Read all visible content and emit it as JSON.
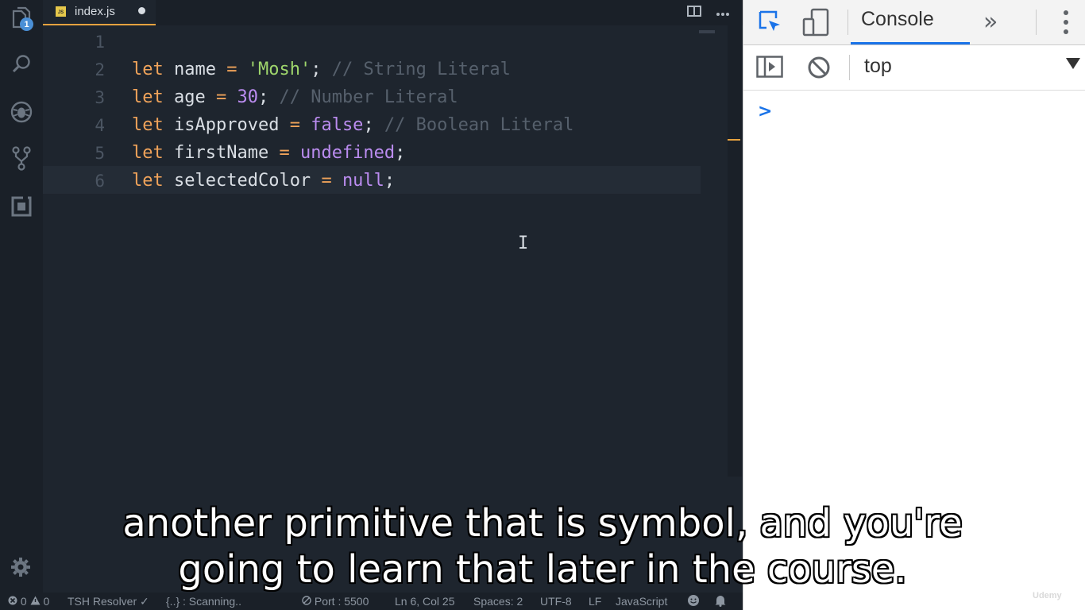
{
  "editor": {
    "tab": {
      "file_icon": "JS",
      "filename": "index.js"
    },
    "lines": [
      {
        "number": "1"
      },
      {
        "number": "2",
        "kw": "let",
        "ident": " name ",
        "op": "=",
        "sp": " ",
        "value": "'Mosh'",
        "end": ";",
        "comment": " // String Literal"
      },
      {
        "number": "3",
        "kw": "let",
        "ident": " age ",
        "op": "=",
        "sp": " ",
        "value": "30",
        "end": ";",
        "comment": " // Number Literal"
      },
      {
        "number": "4",
        "kw": "let",
        "ident": " isApproved ",
        "op": "=",
        "sp": " ",
        "value": "false",
        "end": ";",
        "comment": " // Boolean Literal"
      },
      {
        "number": "5",
        "kw": "let",
        "ident": " firstName ",
        "op": "=",
        "sp": " ",
        "value": "undefined",
        "end": ";"
      },
      {
        "number": "6",
        "kw": "let",
        "ident": " selectedColor ",
        "op": "=",
        "sp": " ",
        "value": "null",
        "end": ";"
      }
    ],
    "explorer_badge": "1",
    "cursor_glyph": "I"
  },
  "status_bar": {
    "errors": "0",
    "warnings": "0",
    "resolver": "TSH Resolver ✓",
    "scanning": "{..} : Scanning..",
    "port": "Port : 5500",
    "position": "Ln 6, Col 25",
    "spaces": "Spaces: 2",
    "encoding": "UTF-8",
    "eol": "LF",
    "language": "JavaScript"
  },
  "devtools": {
    "tab_label": "Console",
    "more_tabs": "»",
    "context": "top",
    "prompt": ">"
  },
  "subtitles": {
    "line1": "another primitive that is symbol, and you're",
    "line2": "going to learn that later in the course."
  },
  "watermark": "Udemy",
  "icons": [
    "explorer-icon",
    "search-icon",
    "debug-icon",
    "source-control-icon",
    "extensions-icon",
    "settings-gear-icon",
    "split-editor-icon",
    "more-actions-icon",
    "inspect-element-icon",
    "device-toolbar-icon",
    "kebab-menu-icon",
    "sidebar-toggle-icon",
    "clear-console-icon"
  ],
  "colors": {
    "accent": "#e5a23f",
    "keyword": "#f0a35a",
    "string": "#9fd66c",
    "literal": "#bb8cf0",
    "devtools_blue": "#1a73e8"
  }
}
